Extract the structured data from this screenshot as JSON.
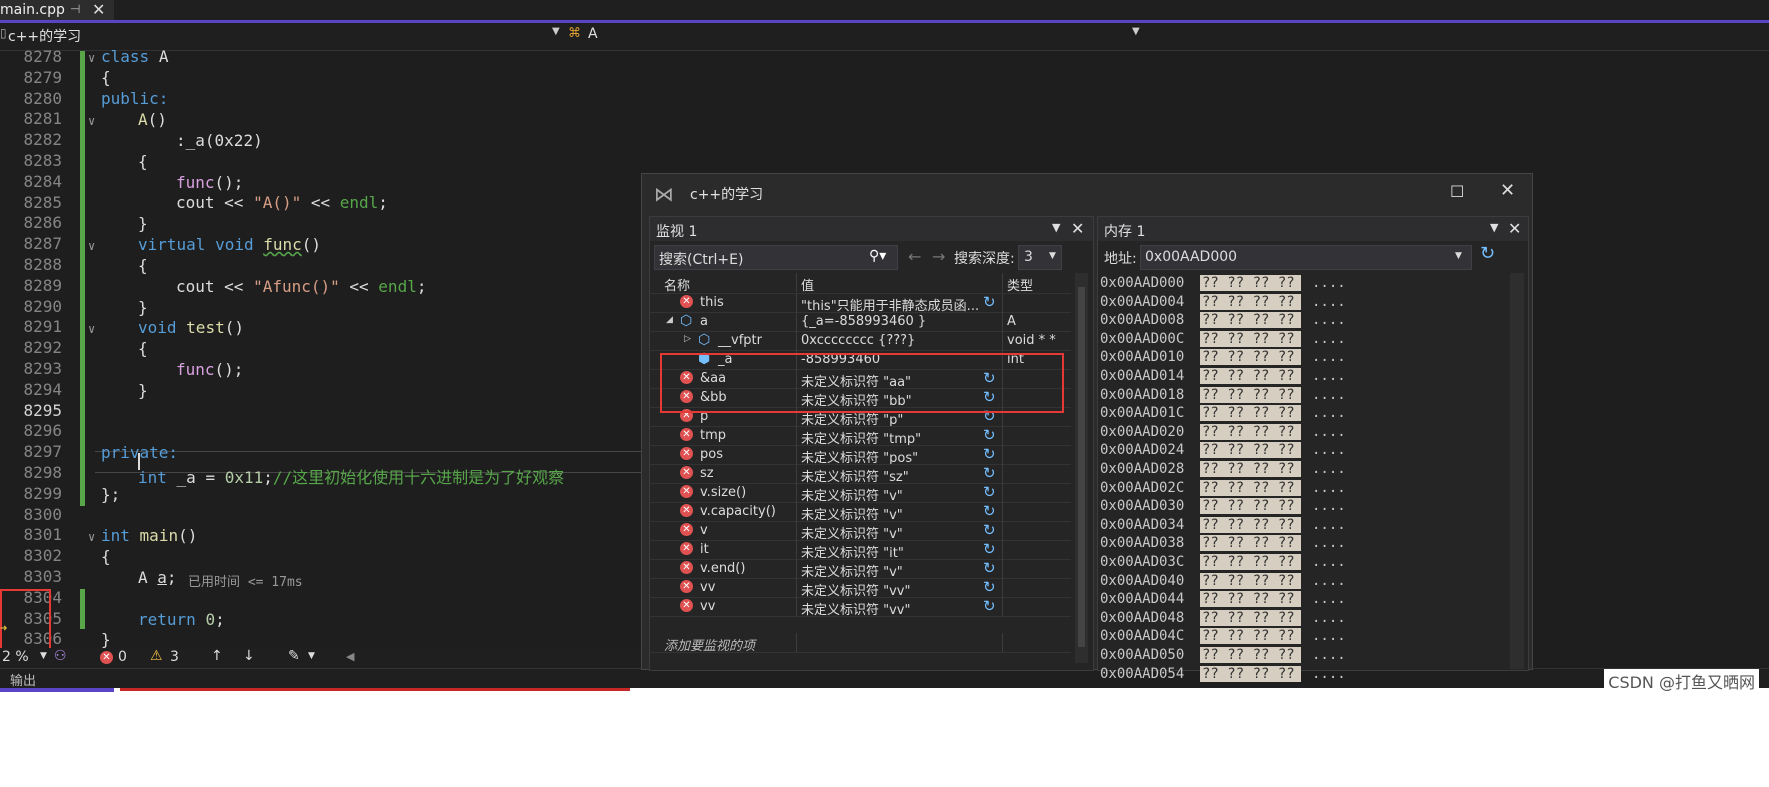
{
  "tab": {
    "filename": "main.cpp",
    "pin": "⊣",
    "close": "✕"
  },
  "navbar": {
    "project": "c++的学习",
    "scope": "A"
  },
  "editor": {
    "line_numbers": [
      "8278",
      "8279",
      "8280",
      "8281",
      "8282",
      "8283",
      "8284",
      "8285",
      "8286",
      "8287",
      "8288",
      "8289",
      "8290",
      "8291",
      "8292",
      "8293",
      "8294",
      "8295",
      "8296",
      "8297",
      "8298",
      "8299",
      "8300",
      "8301",
      "8302",
      "8303",
      "8304",
      "8305",
      "8306"
    ],
    "lines": {
      "l0": {
        "kw": "class",
        "name": "A"
      },
      "l1": "{",
      "l2": "public:",
      "l3": {
        "fn": "A",
        "rest": "()"
      },
      "l4": {
        "pre": ":",
        "fn": "_a",
        "rest": "(0x22)"
      },
      "l5": "{",
      "l6": {
        "fn": "func",
        "rest": "();"
      },
      "l7": {
        "a": "cout << ",
        "s": "\"A()\"",
        "b": " << ",
        "e": "endl",
        "c": ";"
      },
      "l8": "}",
      "l9": {
        "kw1": "virtual",
        "kw2": "void",
        "fn": "func",
        "rest": "()"
      },
      "l10": "{",
      "l11": {
        "a": "cout << ",
        "s": "\"Afunc()\"",
        "b": " << ",
        "e": "endl",
        "c": ";"
      },
      "l12": "}",
      "l13": {
        "kw": "void",
        "fn": "test",
        "rest": "()"
      },
      "l14": "{",
      "l15": {
        "fn": "func",
        "rest": "();"
      },
      "l16": "}",
      "l19": "private:",
      "l20": {
        "kw": "int",
        "name": "_a",
        "eq": " = ",
        "num": "0x11",
        "semi": ";",
        "cmt": "//这里初始化使用十六进制是为了好观察"
      },
      "l21": "};",
      "l23": {
        "kw": "int",
        "fn": "main",
        "rest": "()"
      },
      "l24": "{",
      "l25": {
        "t": "A",
        "v": "a",
        "semi": ";",
        "hint": "已用时间 <= 17ms"
      },
      "l27": {
        "kw": "return",
        "num": "0",
        "semi": ";"
      },
      "l28": "}"
    },
    "status": {
      "zoom": "2 %",
      "errors": "0",
      "warnings": "3"
    }
  },
  "output_label": "输出",
  "watermark": "CSDN @打鱼又晒网",
  "float_window": {
    "title": "c++的学习"
  },
  "watch": {
    "title": "监视 1",
    "search_placeholder": "搜索(Ctrl+E)",
    "depth_label": "搜索深度:",
    "depth_value": "3",
    "columns": [
      "名称",
      "值",
      "类型"
    ],
    "rows": [
      {
        "name": "this",
        "value": "\"this\"只能用于非静态成员函...",
        "type": "",
        "icon": "error",
        "refresh": true
      },
      {
        "name": "a",
        "value": "{_a=-858993460 }",
        "type": "A",
        "icon": "object",
        "expanded": true
      },
      {
        "name": "__vfptr",
        "value": "0xcccccccc {???}",
        "type": "void * *",
        "icon": "object",
        "collapsed": true
      },
      {
        "name": "_a",
        "value": "-858993460",
        "type": "int",
        "icon": "field"
      },
      {
        "name": "&aa",
        "value": "未定义标识符 \"aa\"",
        "type": "",
        "icon": "error",
        "refresh": true
      },
      {
        "name": "&bb",
        "value": "未定义标识符 \"bb\"",
        "type": "",
        "icon": "error",
        "refresh": true
      },
      {
        "name": "p",
        "value": "未定义标识符 \"p\"",
        "type": "",
        "icon": "error",
        "refresh": true
      },
      {
        "name": "tmp",
        "value": "未定义标识符 \"tmp\"",
        "type": "",
        "icon": "error",
        "refresh": true
      },
      {
        "name": "pos",
        "value": "未定义标识符 \"pos\"",
        "type": "",
        "icon": "error",
        "refresh": true
      },
      {
        "name": "sz",
        "value": "未定义标识符 \"sz\"",
        "type": "",
        "icon": "error",
        "refresh": true
      },
      {
        "name": "v.size()",
        "value": "未定义标识符 \"v\"",
        "type": "",
        "icon": "error",
        "refresh": true
      },
      {
        "name": "v.capacity()",
        "value": "未定义标识符 \"v\"",
        "type": "",
        "icon": "error",
        "refresh": true
      },
      {
        "name": "v",
        "value": "未定义标识符 \"v\"",
        "type": "",
        "icon": "error",
        "refresh": true
      },
      {
        "name": "it",
        "value": "未定义标识符 \"it\"",
        "type": "",
        "icon": "error",
        "refresh": true
      },
      {
        "name": "v.end()",
        "value": "未定义标识符 \"v\"",
        "type": "",
        "icon": "error",
        "refresh": true
      },
      {
        "name": "vv",
        "value": "未定义标识符 \"vv\"",
        "type": "",
        "icon": "error",
        "refresh": true
      },
      {
        "name": "vv",
        "value": "未定义标识符 \"vv\"",
        "type": "",
        "icon": "error",
        "refresh": true
      }
    ],
    "add_placeholder": "添加要监视的项"
  },
  "memory": {
    "title": "内存 1",
    "address_label": "地址:",
    "address_value": "0x00AAD000",
    "rows": [
      {
        "addr": "0x00AAD000",
        "hex": "?? ?? ?? ??",
        "ascii": "...."
      },
      {
        "addr": "0x00AAD004",
        "hex": "?? ?? ?? ??",
        "ascii": "...."
      },
      {
        "addr": "0x00AAD008",
        "hex": "?? ?? ?? ??",
        "ascii": "...."
      },
      {
        "addr": "0x00AAD00C",
        "hex": "?? ?? ?? ??",
        "ascii": "...."
      },
      {
        "addr": "0x00AAD010",
        "hex": "?? ?? ?? ??",
        "ascii": "...."
      },
      {
        "addr": "0x00AAD014",
        "hex": "?? ?? ?? ??",
        "ascii": "...."
      },
      {
        "addr": "0x00AAD018",
        "hex": "?? ?? ?? ??",
        "ascii": "...."
      },
      {
        "addr": "0x00AAD01C",
        "hex": "?? ?? ?? ??",
        "ascii": "...."
      },
      {
        "addr": "0x00AAD020",
        "hex": "?? ?? ?? ??",
        "ascii": "...."
      },
      {
        "addr": "0x00AAD024",
        "hex": "?? ?? ?? ??",
        "ascii": "...."
      },
      {
        "addr": "0x00AAD028",
        "hex": "?? ?? ?? ??",
        "ascii": "...."
      },
      {
        "addr": "0x00AAD02C",
        "hex": "?? ?? ?? ??",
        "ascii": "...."
      },
      {
        "addr": "0x00AAD030",
        "hex": "?? ?? ?? ??",
        "ascii": "...."
      },
      {
        "addr": "0x00AAD034",
        "hex": "?? ?? ?? ??",
        "ascii": "...."
      },
      {
        "addr": "0x00AAD038",
        "hex": "?? ?? ?? ??",
        "ascii": "...."
      },
      {
        "addr": "0x00AAD03C",
        "hex": "?? ?? ?? ??",
        "ascii": "...."
      },
      {
        "addr": "0x00AAD040",
        "hex": "?? ?? ?? ??",
        "ascii": "...."
      },
      {
        "addr": "0x00AAD044",
        "hex": "?? ?? ?? ??",
        "ascii": "...."
      },
      {
        "addr": "0x00AAD048",
        "hex": "?? ?? ?? ??",
        "ascii": "...."
      },
      {
        "addr": "0x00AAD04C",
        "hex": "?? ?? ?? ??",
        "ascii": "...."
      },
      {
        "addr": "0x00AAD050",
        "hex": "?? ?? ?? ??",
        "ascii": "...."
      },
      {
        "addr": "0x00AAD054",
        "hex": "?? ?? ?? ??",
        "ascii": "...."
      }
    ]
  },
  "colors": {
    "accent": "#5a45c7",
    "highlight_box": "#e53935",
    "error": "#e05252",
    "change_bar": "#57a64a"
  }
}
